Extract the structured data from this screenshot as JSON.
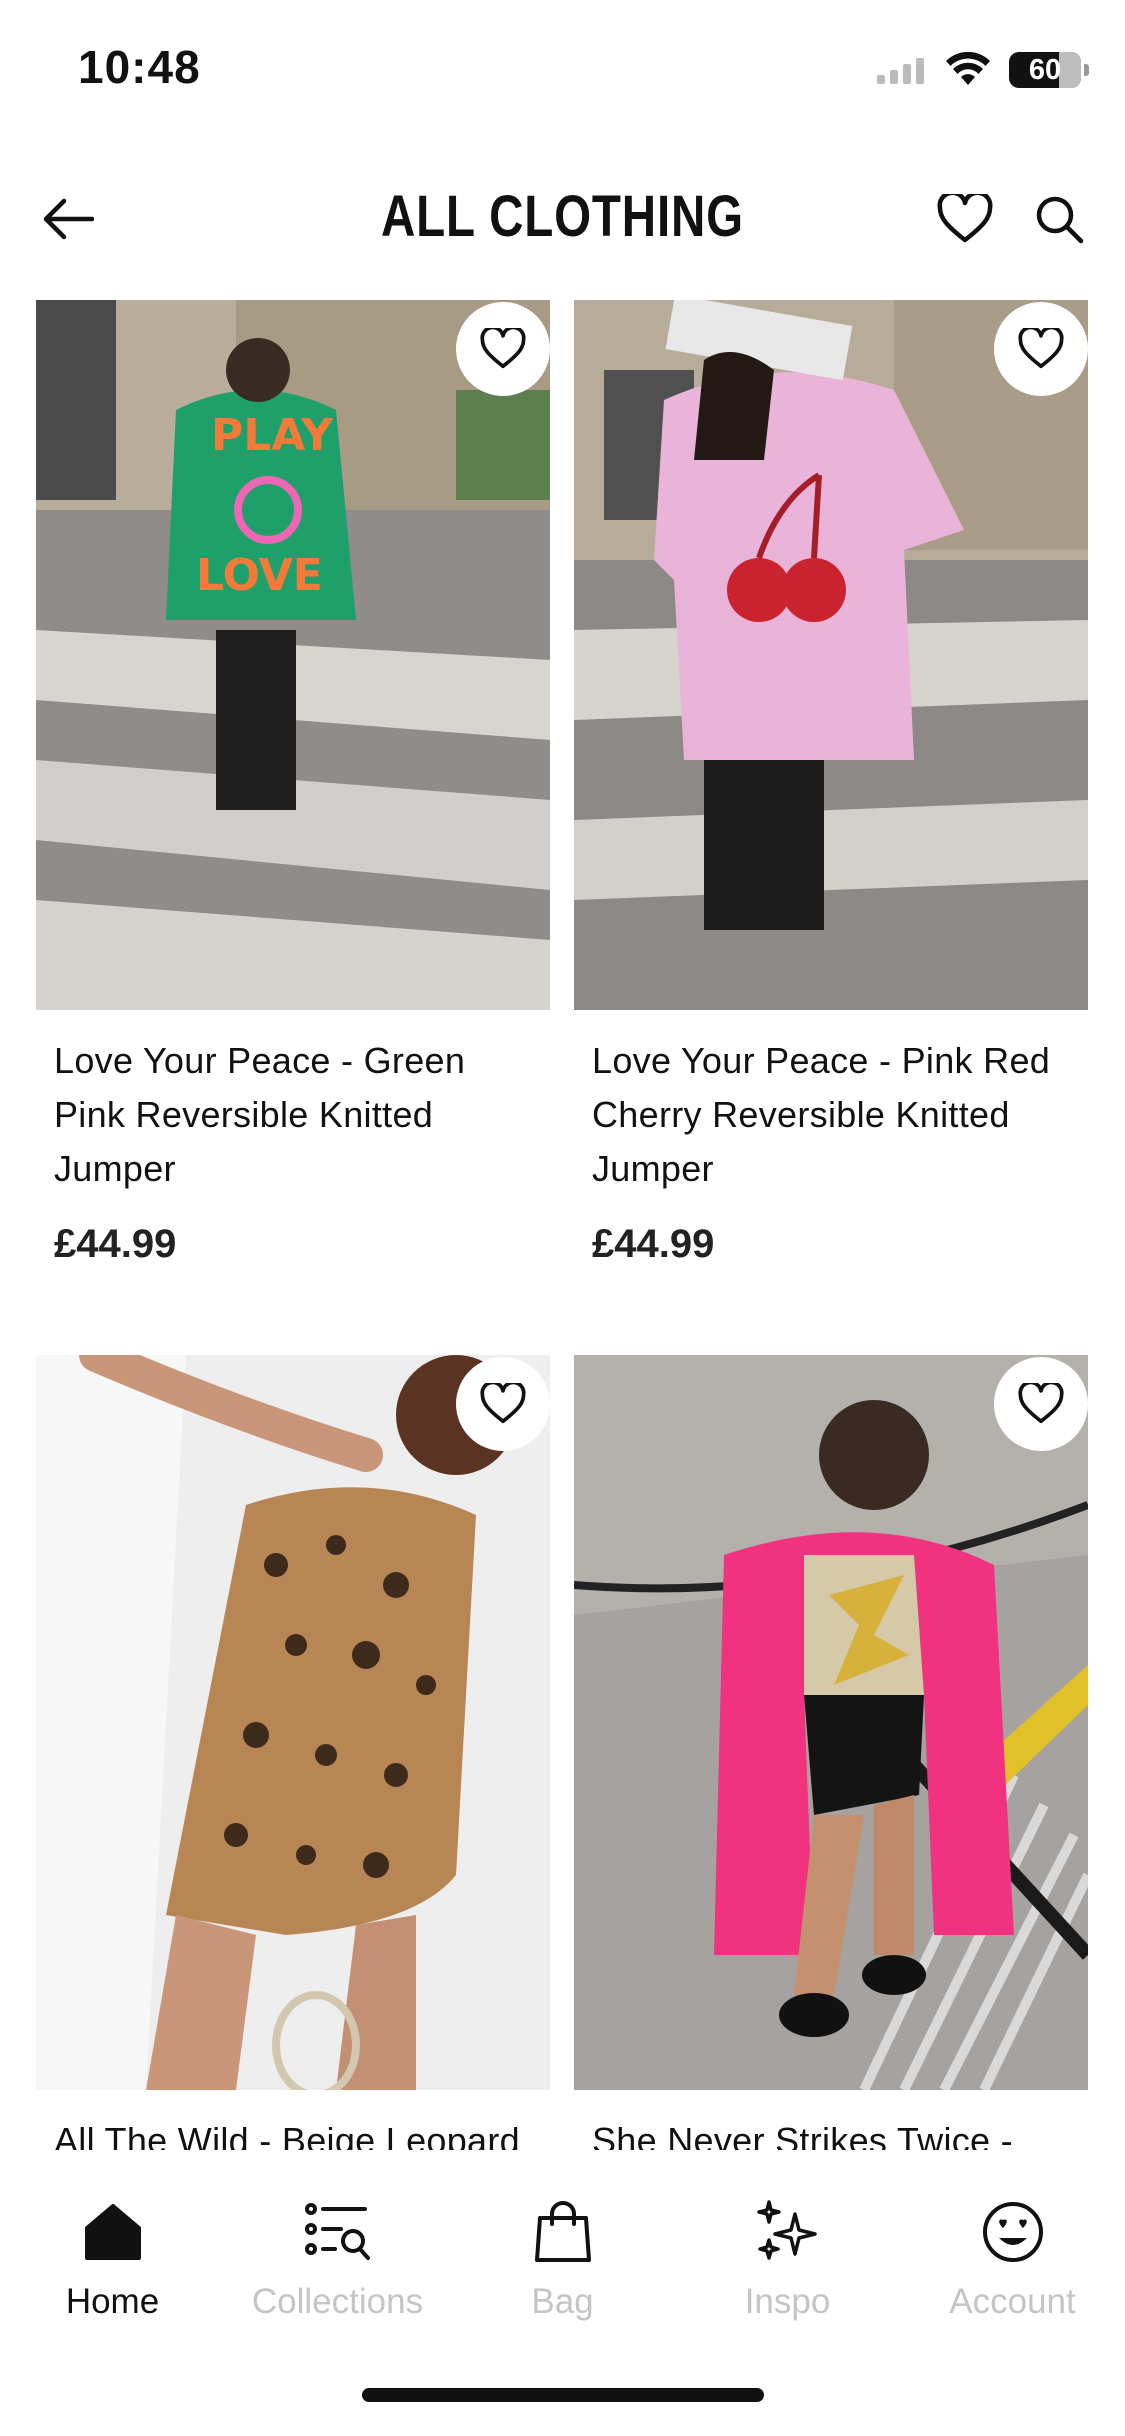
{
  "status_bar": {
    "time": "10:48",
    "battery": "60"
  },
  "header": {
    "title": "ALL CLOTHING"
  },
  "products": [
    {
      "name": "Love Your Peace - Green Pink Reversible Knitted Jumper",
      "price": "£44.99"
    },
    {
      "name": "Love Your Peace - Pink Red Cherry Reversible Knitted Jumper",
      "price": "£44.99"
    },
    {
      "name": "All The Wild - Beige Leopard",
      "price": ""
    },
    {
      "name": "She Never Strikes Twice -",
      "price": ""
    }
  ],
  "tab_bar": {
    "tabs": [
      {
        "label": "Home",
        "icon": "home-icon"
      },
      {
        "label": "Collections",
        "icon": "collections-icon"
      },
      {
        "label": "Bag",
        "icon": "bag-icon"
      },
      {
        "label": "Inspo",
        "icon": "sparkles-icon"
      },
      {
        "label": "Account",
        "icon": "smiley-icon"
      }
    ]
  },
  "colors": {
    "accent": "#111111",
    "inactive": "#c4c4c4",
    "background": "#ffffff"
  }
}
